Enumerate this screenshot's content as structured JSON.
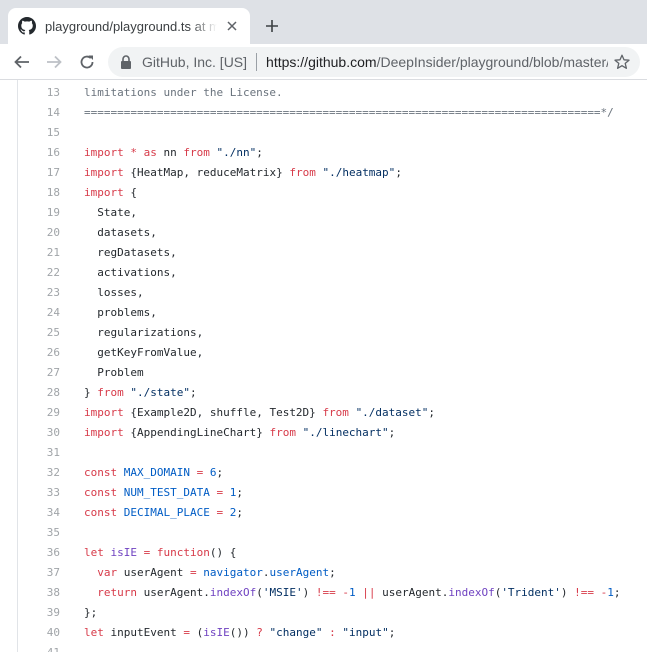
{
  "browser": {
    "tab": {
      "title": "playground/playground.ts at master · DeepInsider/playground"
    },
    "origin_chip": "GitHub, Inc. [US]",
    "url_host": "https://github.com",
    "url_path": "/DeepInsider/playground/blob/master/src/playground.ts",
    "icons": {
      "favicon": "github-icon",
      "close": "close-icon",
      "new_tab": "plus-icon",
      "back": "back-arrow-icon",
      "forward": "forward-arrow-icon",
      "reload": "reload-icon",
      "lock": "lock-icon",
      "bookmark": "star-icon"
    }
  },
  "colors": {
    "keyword": "#d73a49",
    "string": "#032f62",
    "function": "#6f42c1",
    "constant": "#005cc5",
    "comment": "#6a737d",
    "line_number": "#a0a4a8"
  },
  "code": {
    "lines": [
      {
        "n": "13",
        "tokens": [
          [
            "c",
            "limitations under the License."
          ]
        ]
      },
      {
        "n": "14",
        "tokens": [
          [
            "c",
            "==============================================================================*/"
          ]
        ]
      },
      {
        "n": "15",
        "tokens": []
      },
      {
        "n": "16",
        "tokens": [
          [
            "k",
            "import"
          ],
          [
            "t",
            " "
          ],
          [
            "k",
            "*"
          ],
          [
            "t",
            " "
          ],
          [
            "k",
            "as"
          ],
          [
            "t",
            " nn "
          ],
          [
            "k",
            "from"
          ],
          [
            "t",
            " "
          ],
          [
            "s",
            "\"./nn\""
          ],
          [
            "t",
            ";"
          ]
        ]
      },
      {
        "n": "17",
        "tokens": [
          [
            "k",
            "import"
          ],
          [
            "t",
            " {HeatMap, reduceMatrix} "
          ],
          [
            "k",
            "from"
          ],
          [
            "t",
            " "
          ],
          [
            "s",
            "\"./heatmap\""
          ],
          [
            "t",
            ";"
          ]
        ]
      },
      {
        "n": "18",
        "tokens": [
          [
            "k",
            "import"
          ],
          [
            "t",
            " {"
          ]
        ]
      },
      {
        "n": "19",
        "tokens": [
          [
            "t",
            "  State,"
          ]
        ]
      },
      {
        "n": "20",
        "tokens": [
          [
            "t",
            "  datasets,"
          ]
        ]
      },
      {
        "n": "21",
        "tokens": [
          [
            "t",
            "  regDatasets,"
          ]
        ]
      },
      {
        "n": "22",
        "tokens": [
          [
            "t",
            "  activations,"
          ]
        ]
      },
      {
        "n": "23",
        "tokens": [
          [
            "t",
            "  losses,"
          ]
        ]
      },
      {
        "n": "24",
        "tokens": [
          [
            "t",
            "  problems,"
          ]
        ]
      },
      {
        "n": "25",
        "tokens": [
          [
            "t",
            "  regularizations,"
          ]
        ]
      },
      {
        "n": "26",
        "tokens": [
          [
            "t",
            "  getKeyFromValue,"
          ]
        ]
      },
      {
        "n": "27",
        "tokens": [
          [
            "t",
            "  Problem"
          ]
        ]
      },
      {
        "n": "28",
        "tokens": [
          [
            "t",
            "} "
          ],
          [
            "k",
            "from"
          ],
          [
            "t",
            " "
          ],
          [
            "s",
            "\"./state\""
          ],
          [
            "t",
            ";"
          ]
        ]
      },
      {
        "n": "29",
        "tokens": [
          [
            "k",
            "import"
          ],
          [
            "t",
            " {Example2D, shuffle, Test2D} "
          ],
          [
            "k",
            "from"
          ],
          [
            "t",
            " "
          ],
          [
            "s",
            "\"./dataset\""
          ],
          [
            "t",
            ";"
          ]
        ]
      },
      {
        "n": "30",
        "tokens": [
          [
            "k",
            "import"
          ],
          [
            "t",
            " {AppendingLineChart} "
          ],
          [
            "k",
            "from"
          ],
          [
            "t",
            " "
          ],
          [
            "s",
            "\"./linechart\""
          ],
          [
            "t",
            ";"
          ]
        ]
      },
      {
        "n": "31",
        "tokens": []
      },
      {
        "n": "32",
        "tokens": [
          [
            "k",
            "const"
          ],
          [
            "t",
            " "
          ],
          [
            "p",
            "MAX_DOMAIN"
          ],
          [
            "t",
            " "
          ],
          [
            "k",
            "="
          ],
          [
            "t",
            " "
          ],
          [
            "p",
            "6"
          ],
          [
            "t",
            ";"
          ]
        ]
      },
      {
        "n": "33",
        "tokens": [
          [
            "k",
            "const"
          ],
          [
            "t",
            " "
          ],
          [
            "p",
            "NUM_TEST_DATA"
          ],
          [
            "t",
            " "
          ],
          [
            "k",
            "="
          ],
          [
            "t",
            " "
          ],
          [
            "p",
            "1"
          ],
          [
            "t",
            ";"
          ]
        ]
      },
      {
        "n": "34",
        "tokens": [
          [
            "k",
            "const"
          ],
          [
            "t",
            " "
          ],
          [
            "p",
            "DECIMAL_PLACE"
          ],
          [
            "t",
            " "
          ],
          [
            "k",
            "="
          ],
          [
            "t",
            " "
          ],
          [
            "p",
            "2"
          ],
          [
            "t",
            ";"
          ]
        ]
      },
      {
        "n": "35",
        "tokens": []
      },
      {
        "n": "36",
        "tokens": [
          [
            "k",
            "let"
          ],
          [
            "t",
            " "
          ],
          [
            "f",
            "isIE"
          ],
          [
            "t",
            " "
          ],
          [
            "k",
            "="
          ],
          [
            "t",
            " "
          ],
          [
            "k",
            "function"
          ],
          [
            "t",
            "() {"
          ]
        ]
      },
      {
        "n": "37",
        "tokens": [
          [
            "t",
            "  "
          ],
          [
            "k",
            "var"
          ],
          [
            "t",
            " userAgent "
          ],
          [
            "k",
            "="
          ],
          [
            "t",
            " "
          ],
          [
            "p",
            "navigator"
          ],
          [
            "t",
            "."
          ],
          [
            "p",
            "userAgent"
          ],
          [
            "t",
            ";"
          ]
        ]
      },
      {
        "n": "38",
        "tokens": [
          [
            "t",
            "  "
          ],
          [
            "k",
            "return"
          ],
          [
            "t",
            " userAgent."
          ],
          [
            "f",
            "indexOf"
          ],
          [
            "t",
            "("
          ],
          [
            "s",
            "'MSIE'"
          ],
          [
            "t",
            ") "
          ],
          [
            "k",
            "!=="
          ],
          [
            "t",
            " "
          ],
          [
            "k",
            "-"
          ],
          [
            "p",
            "1"
          ],
          [
            "t",
            " "
          ],
          [
            "k",
            "||"
          ],
          [
            "t",
            " userAgent."
          ],
          [
            "f",
            "indexOf"
          ],
          [
            "t",
            "("
          ],
          [
            "s",
            "'Trident'"
          ],
          [
            "t",
            ") "
          ],
          [
            "k",
            "!=="
          ],
          [
            "t",
            " "
          ],
          [
            "k",
            "-"
          ],
          [
            "p",
            "1"
          ],
          [
            "t",
            ";"
          ]
        ]
      },
      {
        "n": "39",
        "tokens": [
          [
            "t",
            "};"
          ]
        ]
      },
      {
        "n": "40",
        "tokens": [
          [
            "k",
            "let"
          ],
          [
            "t",
            " inputEvent "
          ],
          [
            "k",
            "="
          ],
          [
            "t",
            " ("
          ],
          [
            "f",
            "isIE"
          ],
          [
            "t",
            "()) "
          ],
          [
            "k",
            "?"
          ],
          [
            "t",
            " "
          ],
          [
            "s",
            "\"change\""
          ],
          [
            "t",
            " "
          ],
          [
            "k",
            ":"
          ],
          [
            "t",
            " "
          ],
          [
            "s",
            "\"input\""
          ],
          [
            "t",
            ";"
          ]
        ]
      },
      {
        "n": "41",
        "tokens": []
      }
    ]
  }
}
